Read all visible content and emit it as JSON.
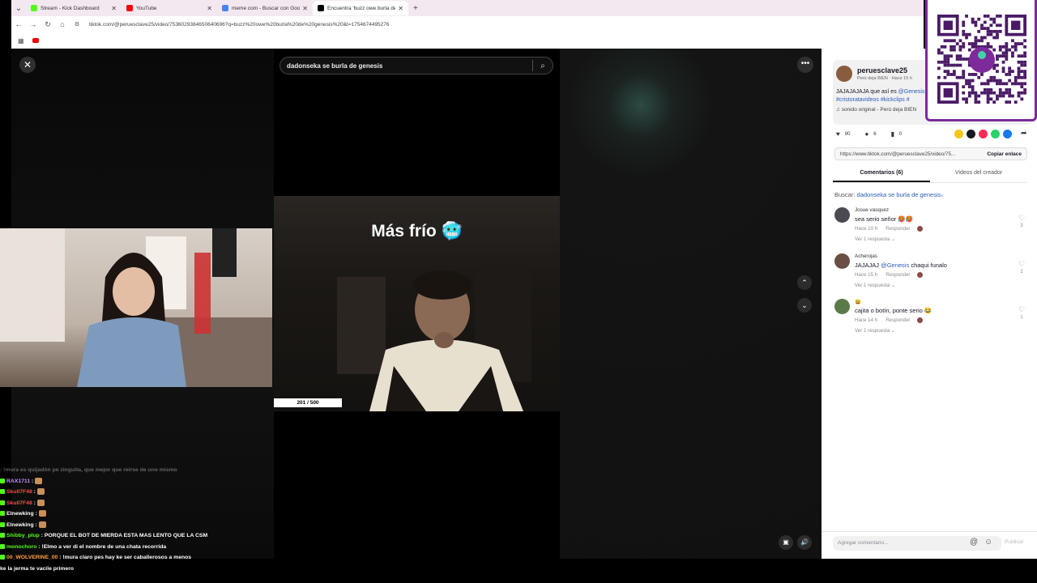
{
  "browser": {
    "tabs": [
      {
        "title": "Stream - Kick Dashboard",
        "favicon_color": "#53fc18",
        "active": false
      },
      {
        "title": "YouTube",
        "favicon_color": "#ff0000",
        "active": false
      },
      {
        "title": "meme com - Buscar con Google",
        "favicon_color": "#4285f4",
        "active": false
      },
      {
        "title": "Encuentra 'buzz owe burla de genesis'",
        "favicon_color": "#000000",
        "active": true
      }
    ],
    "new_tab": "+",
    "url": "tiktok.com/@peruesclave25/video/7536029384650640696?q=buzz%20owe%20burla%20de%20genesis%20&t=1754674495276"
  },
  "player": {
    "search_query": "dadonseka se burla de genesis",
    "video_caption": "Más frío 🥶",
    "counter": "201 / 500",
    "icons": {
      "close": "close-icon",
      "more": "more-icon",
      "up": "chevron-up-icon",
      "down": "chevron-down-icon",
      "volume": "volume-icon",
      "pip": "pip-icon"
    }
  },
  "chat": [
    {
      "user": "",
      "user_color": "#8f8f8f",
      "text": ": !mura es quijadón pe zinguita, que mejor que reirse de uno mismo",
      "faded": true
    },
    {
      "user": "RAX1711",
      "user_color": "#c58bff",
      "text": ":",
      "emote": true
    },
    {
      "user": "Skull7F48",
      "user_color": "#ff4a4a",
      "text": ":",
      "emote": true
    },
    {
      "user": "Skull7F48",
      "user_color": "#ff4a4a",
      "text": ":",
      "emote": true
    },
    {
      "user": "Elnewking",
      "user_color": "#ffffff",
      "text": ":",
      "emote": true
    },
    {
      "user": "Elnewking",
      "user_color": "#ffffff",
      "text": ":",
      "emote": true
    },
    {
      "user": "Shibby_plup",
      "user_color": "#53fc18",
      "text": ": PORQUE EL BOT DE MIERDA ESTA MAS LENTO QUE LA CSM",
      "emote": false
    },
    {
      "user": "monochoro",
      "user_color": "#53fc18",
      "text": ": !Elmo a ver di el nombre de una chata recorrida",
      "emote": false
    },
    {
      "user": "00_WOLVERINE_00",
      "user_color": "#ff9e3d",
      "text": ": !mura claro pes hay ke ser caballerosos a menos",
      "emote": false
    },
    {
      "user": "",
      "user_color": "#ffffff",
      "text": "ke la jerma te vacile primero",
      "emote": false
    }
  ],
  "panel": {
    "author": "peruesclave25",
    "author_sub": "Perú deja BIEN · Hace 15 h",
    "description": "JAJAJAJAJA que así es",
    "description_mention": "@Genesis",
    "description_tags": "#cristoratavideos #kickclips #",
    "sound": "sonido original - Perú deja BIEN",
    "likes": "90",
    "comments": "6",
    "saves": "0",
    "share_colors": [
      "#f5c518",
      "#161823",
      "#fe2c55",
      "#25d366",
      "#1877f2"
    ],
    "link": "https://www.tiktok.com/@peruesclave25/video/75...",
    "copy_label": "Copiar enlace",
    "tabs": [
      "Comentarios (6)",
      "Videos del creador"
    ],
    "search_label": "Buscar:",
    "search_query": "dadonseka se burla de genesis",
    "comments_list": [
      {
        "user": "Josue vasquez",
        "text": "sea serio señor 🥵🥵",
        "mention": "",
        "after": "",
        "time": "Hace 10 h",
        "reply": "Responder",
        "replies": "Ver 1 respuesta ⌄",
        "likes": "3",
        "avatar": "#4a4a52"
      },
      {
        "user": "Acherojas",
        "text": "JAJAJAJ ",
        "mention": "@Genesis",
        "after": " chaqui funalo",
        "time": "Hace 15 h",
        "reply": "Responder",
        "replies": "Ver 1 respuesta ⌄",
        "likes": "2",
        "avatar": "#6a4f45"
      },
      {
        "user": "😃",
        "text": "cajita o botín, ponte serio 😂",
        "mention": "",
        "after": "",
        "time": "Hace 14 h",
        "reply": "Responder",
        "replies": "Ver 1 respuesta ⌄",
        "likes": "1",
        "avatar": "#5a7a4a"
      }
    ],
    "compose_placeholder": "Agregar comentario...",
    "publish": "Publicar"
  },
  "overlay": {
    "qr_brand": "yape",
    "qr_color": "#7d2a9a"
  }
}
